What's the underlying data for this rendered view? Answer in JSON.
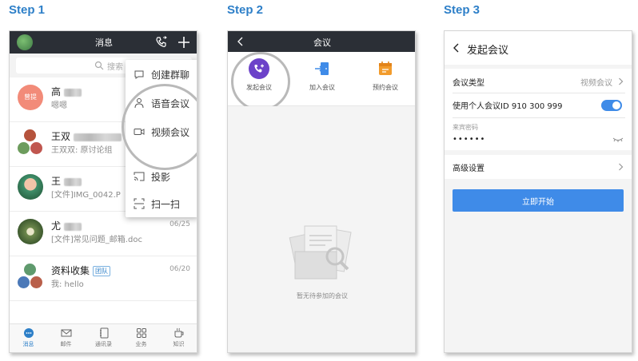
{
  "steps": [
    "Step 1",
    "Step 2",
    "Step 3"
  ],
  "accent_color": "#2d7fc8",
  "phone1": {
    "header_title": "消息",
    "search_placeholder": "搜索",
    "chats": [
      {
        "name": "高",
        "preview": "嗯嗯",
        "time": "",
        "avatar_text": "曾提"
      },
      {
        "name": "王双",
        "preview": "王双双: 原讨论组",
        "time": ""
      },
      {
        "name": "王",
        "preview": "[文件]IMG_0042.P",
        "time": ""
      },
      {
        "name": "尤",
        "preview": "[文件]常见问题_邮箱.doc",
        "time": "06/25"
      },
      {
        "name": "资料收集",
        "badge": "团队",
        "preview": "我: hello",
        "time": "06/20"
      }
    ],
    "popup_menu": [
      {
        "label": "创建群聊",
        "icon": "chat-bubble-icon"
      },
      {
        "label": "语音会议",
        "icon": "voice-meeting-icon"
      },
      {
        "label": "视频会议",
        "icon": "video-camera-icon"
      },
      {
        "label": "投影",
        "icon": "cast-icon"
      },
      {
        "label": "扫一扫",
        "icon": "scan-icon"
      }
    ],
    "tabs": [
      {
        "label": "消息",
        "icon": "message-icon",
        "active": true
      },
      {
        "label": "邮件",
        "icon": "mail-icon",
        "active": false
      },
      {
        "label": "通讯录",
        "icon": "contacts-icon",
        "active": false
      },
      {
        "label": "业务",
        "icon": "apps-grid-icon",
        "active": false
      },
      {
        "label": "知识",
        "icon": "coffee-icon",
        "active": false
      }
    ]
  },
  "phone2": {
    "header_title": "会议",
    "actions": [
      {
        "label": "发起会议",
        "icon": "start-meeting-icon",
        "color": "#6a3fc8"
      },
      {
        "label": "加入会议",
        "icon": "join-meeting-icon",
        "color": "#3f8be8"
      },
      {
        "label": "预约会议",
        "icon": "calendar-icon",
        "color": "#f29b2c"
      }
    ],
    "empty_text": "暂无待参加的会议"
  },
  "phone3": {
    "header_title": "发起会议",
    "meeting_type_label": "会议类型",
    "meeting_type_value": "视频会议",
    "personal_id_label": "使用个人会议ID 910 300 999",
    "personal_id_enabled": true,
    "password_label": "来宾密码",
    "password_value": "••••••",
    "advanced_label": "高级设置",
    "start_button": "立即开始"
  }
}
